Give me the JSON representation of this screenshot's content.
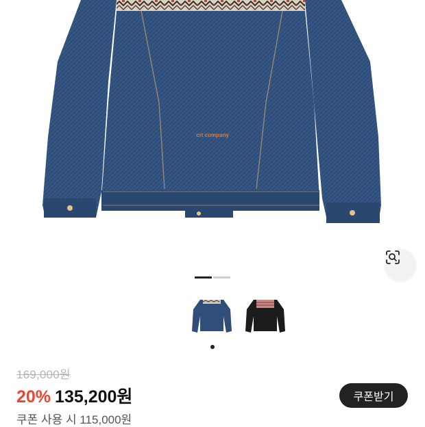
{
  "product": {
    "image_label": "denim jacket back view",
    "embroidery_text": "crt company",
    "thumbnails": [
      {
        "name": "blue denim jacket with pattern yoke"
      },
      {
        "name": "black jacket with pattern yoke"
      }
    ],
    "pager": {
      "total": 2,
      "active": 1
    }
  },
  "pricing": {
    "original_price": "169,000원",
    "discount_rate": "20%",
    "sale_price": "135,200원",
    "coupon_note": "쿠폰 사용 시 115,000원",
    "coupon_button": "쿠폰받기"
  },
  "icons": {
    "lens": "image-search-icon"
  },
  "colors": {
    "discount": "#f0462d",
    "denim": "#2f4f7a",
    "button_bg": "#222222"
  }
}
